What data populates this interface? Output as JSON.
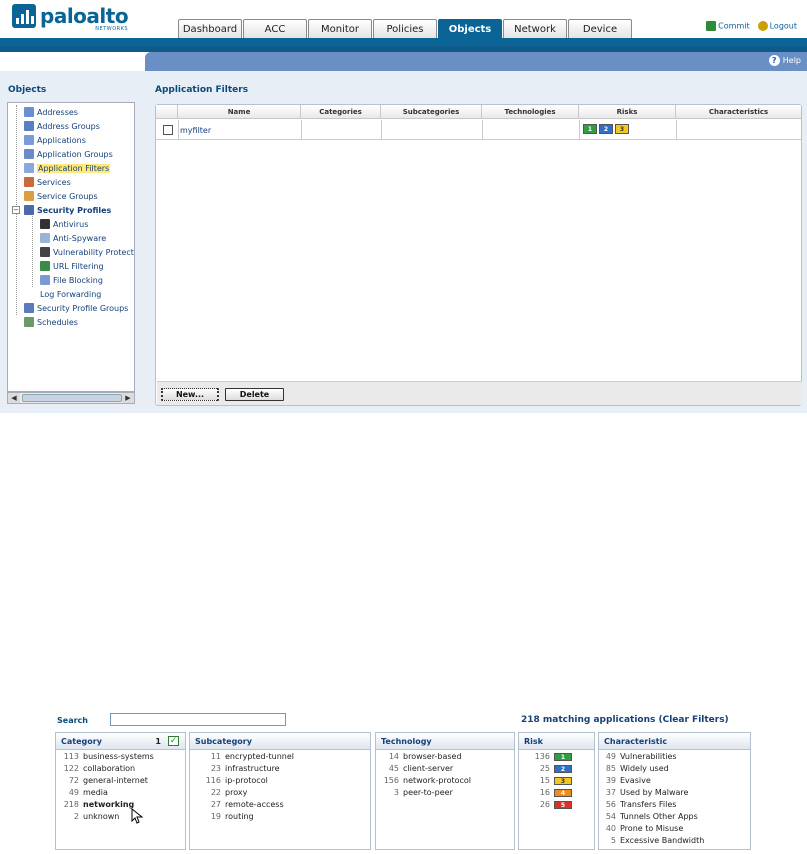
{
  "brand": {
    "name": "paloalto",
    "sub": "NETWORKS"
  },
  "tabs": [
    "Dashboard",
    "ACC",
    "Monitor",
    "Policies",
    "Objects",
    "Network",
    "Device"
  ],
  "active_tab": "Objects",
  "header_actions": {
    "commit": "Commit",
    "logout": "Logout"
  },
  "help_label": "Help",
  "sidebar": {
    "title": "Objects",
    "items": [
      {
        "label": "Addresses"
      },
      {
        "label": "Address Groups"
      },
      {
        "label": "Applications"
      },
      {
        "label": "Application Groups"
      },
      {
        "label": "Application Filters"
      },
      {
        "label": "Services"
      },
      {
        "label": "Service Groups"
      },
      {
        "label": "Security Profiles"
      },
      {
        "label": "Antivirus"
      },
      {
        "label": "Anti-Spyware"
      },
      {
        "label": "Vulnerability Protection"
      },
      {
        "label": "URL Filtering"
      },
      {
        "label": "File Blocking"
      },
      {
        "label": "Log Forwarding"
      },
      {
        "label": "Security Profile Groups"
      },
      {
        "label": "Schedules"
      }
    ],
    "expander": "−"
  },
  "main": {
    "title": "Application Filters",
    "columns": [
      "Name",
      "Categories",
      "Subcategories",
      "Technologies",
      "Risks",
      "Characteristics"
    ],
    "rows": [
      {
        "name": "myfilter",
        "risks": [
          "1",
          "2",
          "3"
        ]
      }
    ],
    "buttons": {
      "new": "New...",
      "delete": "Delete"
    }
  },
  "browser": {
    "search_label": "Search",
    "search_value": "",
    "matching": "218 matching applications (Clear Filters)",
    "category": {
      "title": "Category",
      "selected_count": "1",
      "check": "✓",
      "items": [
        {
          "n": "113",
          "t": "business-systems"
        },
        {
          "n": "122",
          "t": "collaboration"
        },
        {
          "n": "72",
          "t": "general-internet"
        },
        {
          "n": "49",
          "t": "media"
        },
        {
          "n": "218",
          "t": "networking"
        },
        {
          "n": "2",
          "t": "unknown"
        }
      ]
    },
    "subcategory": {
      "title": "Subcategory",
      "items": [
        {
          "n": "11",
          "t": "encrypted-tunnel"
        },
        {
          "n": "23",
          "t": "infrastructure"
        },
        {
          "n": "116",
          "t": "ip-protocol"
        },
        {
          "n": "22",
          "t": "proxy"
        },
        {
          "n": "27",
          "t": "remote-access"
        },
        {
          "n": "19",
          "t": "routing"
        }
      ]
    },
    "technology": {
      "title": "Technology",
      "items": [
        {
          "n": "14",
          "t": "browser-based"
        },
        {
          "n": "45",
          "t": "client-server"
        },
        {
          "n": "156",
          "t": "network-protocol"
        },
        {
          "n": "3",
          "t": "peer-to-peer"
        }
      ]
    },
    "risk": {
      "title": "Risk",
      "items": [
        {
          "n": "136",
          "t": "1"
        },
        {
          "n": "25",
          "t": "2"
        },
        {
          "n": "15",
          "t": "3"
        },
        {
          "n": "16",
          "t": "4"
        },
        {
          "n": "26",
          "t": "5"
        }
      ]
    },
    "characteristic": {
      "title": "Characteristic",
      "items": [
        {
          "n": "49",
          "t": "Vulnerabilities"
        },
        {
          "n": "85",
          "t": "Widely used"
        },
        {
          "n": "39",
          "t": "Evasive"
        },
        {
          "n": "37",
          "t": "Used by Malware"
        },
        {
          "n": "56",
          "t": "Transfers Files"
        },
        {
          "n": "54",
          "t": "Tunnels Other Apps"
        },
        {
          "n": "40",
          "t": "Prone to Misuse"
        },
        {
          "n": "5",
          "t": "Excessive Bandwidth"
        }
      ]
    }
  },
  "colors": {
    "brand": "#0a6496",
    "risk1": "#2ea043",
    "risk2": "#2f6fc7",
    "risk3": "#f2c81a",
    "risk4": "#f08c1e",
    "risk5": "#d9302c"
  }
}
